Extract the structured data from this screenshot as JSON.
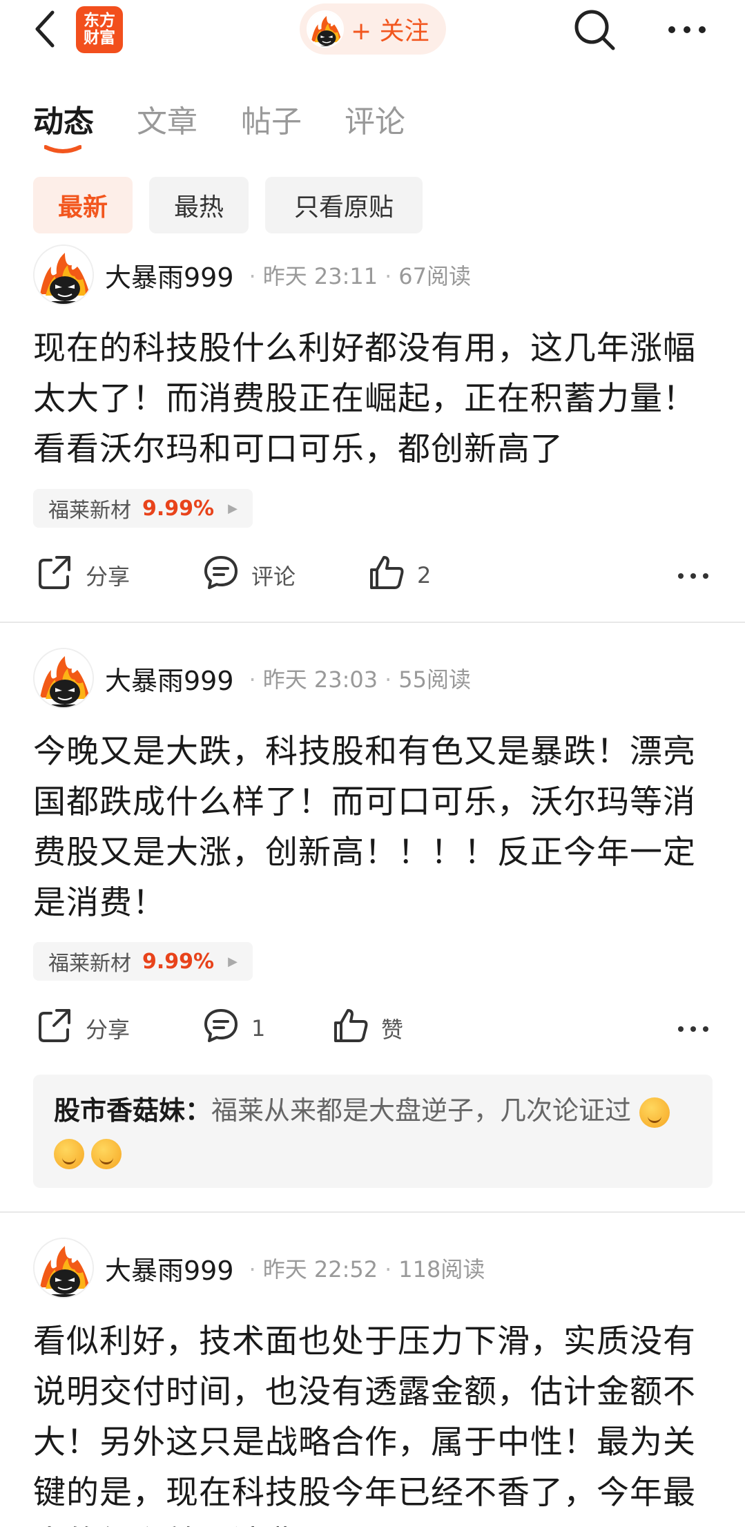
{
  "header": {
    "logo_line1": "东方",
    "logo_line2": "财富",
    "follow_label": "+ 关注"
  },
  "tabs": [
    {
      "label": "动态"
    },
    {
      "label": "文章"
    },
    {
      "label": "帖子"
    },
    {
      "label": "评论"
    }
  ],
  "filters": [
    {
      "label": "最新"
    },
    {
      "label": "最热"
    },
    {
      "label": "只看原贴"
    }
  ],
  "icons": [
    "back-icon",
    "search-icon",
    "more-icon",
    "share-icon",
    "comment-icon",
    "like-icon",
    "play-triangle-icon"
  ],
  "colors": {
    "accent": "#f2561e",
    "price_up": "#e8431b"
  },
  "posts": [
    {
      "author": "大暴雨999",
      "time": "昨天 23:11",
      "reads": "67阅读",
      "text": "现在的科技股什么利好都没有用，这几年涨幅太大了！而消费股正在崛起，正在积蓄力量！看看沃尔玛和可口可乐，都创新高了",
      "stock_name": "福莱新材",
      "stock_change": "9.99%",
      "share_label": "分享",
      "comment_label": "评论",
      "like_label": "2"
    },
    {
      "author": "大暴雨999",
      "time": "昨天 23:03",
      "reads": "55阅读",
      "text": "今晚又是大跌，科技股和有色又是暴跌！漂亮国都跌成什么样了！而可口可乐，沃尔玛等消费股又是大涨，创新高！！！！反正今年一定是消费！",
      "stock_name": "福莱新材",
      "stock_change": "9.99%",
      "share_label": "分享",
      "comment_label": "1",
      "like_label": "赞",
      "comment": {
        "author": "股市香菇妹：",
        "text": "福莱从来都是大盘逆子，几次论证过"
      }
    },
    {
      "author": "大暴雨999",
      "time": "昨天 22:52",
      "reads": "118阅读",
      "text": "看似利好，技术面也处于压力下滑，实质没有说明交付时间，也没有透露金额，估计金额不大！另外这只是战略合作，属于中性！最为关键的是，现在科技股今年已经不香了，今年最大的红利就是消费！"
    }
  ]
}
